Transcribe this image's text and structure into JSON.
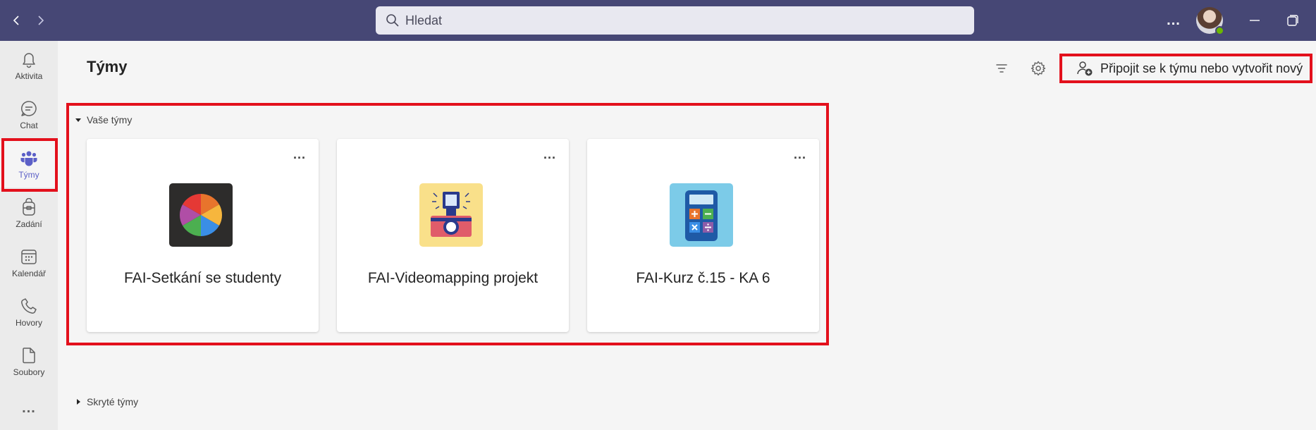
{
  "titlebar": {
    "search_placeholder": "Hledat",
    "more_label": "..."
  },
  "rail": {
    "items": [
      {
        "label": "Aktivita",
        "icon": "bell-icon"
      },
      {
        "label": "Chat",
        "icon": "chat-icon"
      },
      {
        "label": "Týmy",
        "icon": "teams-icon",
        "active": true
      },
      {
        "label": "Zadání",
        "icon": "backpack-icon"
      },
      {
        "label": "Kalendář",
        "icon": "calendar-icon"
      },
      {
        "label": "Hovory",
        "icon": "phone-icon"
      },
      {
        "label": "Soubory",
        "icon": "file-icon"
      }
    ],
    "more_label": "..."
  },
  "header": {
    "title": "Týmy",
    "join_button_label": "Připojit se k týmu nebo vytvořit nový"
  },
  "sections": {
    "your_teams_label": "Vaše týmy",
    "hidden_teams_label": "Skryté týmy"
  },
  "teams": [
    {
      "name": "FAI-Setkání se studenty",
      "icon": "color-wheel-icon",
      "more": "..."
    },
    {
      "name": "FAI-Videomapping projekt",
      "icon": "camera-icon",
      "more": "..."
    },
    {
      "name": "FAI-Kurz č.15 - KA 6",
      "icon": "calculator-icon",
      "more": "..."
    }
  ],
  "colors": {
    "titlebar": "#464775",
    "accent": "#5b5fc7",
    "highlight": "#e3101c",
    "presence": "#6bb700"
  }
}
